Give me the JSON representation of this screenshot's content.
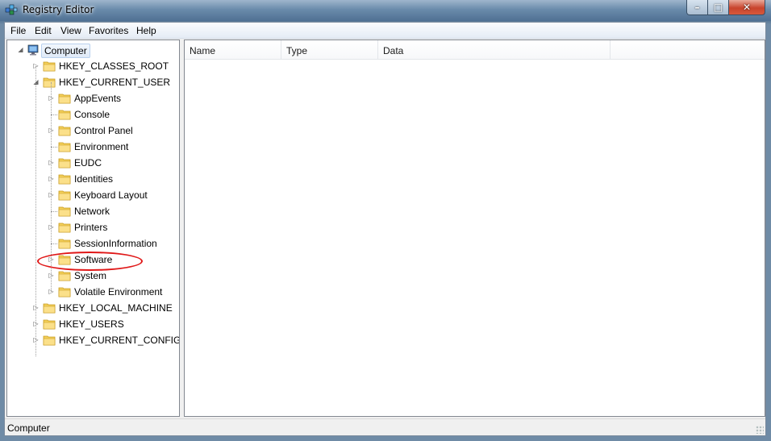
{
  "window": {
    "title": "Registry Editor"
  },
  "menu": [
    "File",
    "Edit",
    "View",
    "Favorites",
    "Help"
  ],
  "tree": {
    "root": "Computer",
    "hives": [
      {
        "label": "HKEY_CLASSES_ROOT",
        "expanded": false
      },
      {
        "label": "HKEY_CURRENT_USER",
        "expanded": true,
        "children": [
          {
            "label": "AppEvents",
            "has_children": true
          },
          {
            "label": "Console",
            "has_children": false
          },
          {
            "label": "Control Panel",
            "has_children": true
          },
          {
            "label": "Environment",
            "has_children": false
          },
          {
            "label": "EUDC",
            "has_children": true
          },
          {
            "label": "Identities",
            "has_children": true
          },
          {
            "label": "Keyboard Layout",
            "has_children": true
          },
          {
            "label": "Network",
            "has_children": false
          },
          {
            "label": "Printers",
            "has_children": true
          },
          {
            "label": "SessionInformation",
            "has_children": false
          },
          {
            "label": "Software",
            "has_children": true,
            "circled": true
          },
          {
            "label": "System",
            "has_children": true
          },
          {
            "label": "Volatile Environment",
            "has_children": true
          }
        ]
      },
      {
        "label": "HKEY_LOCAL_MACHINE",
        "expanded": false
      },
      {
        "label": "HKEY_USERS",
        "expanded": false
      },
      {
        "label": "HKEY_CURRENT_CONFIG",
        "expanded": false
      }
    ]
  },
  "list": {
    "columns": [
      "Name",
      "Type",
      "Data"
    ]
  },
  "status": {
    "text": "Computer"
  },
  "colors": {
    "highlight_oval": "#e01818",
    "folder": "#f3cf5a"
  }
}
